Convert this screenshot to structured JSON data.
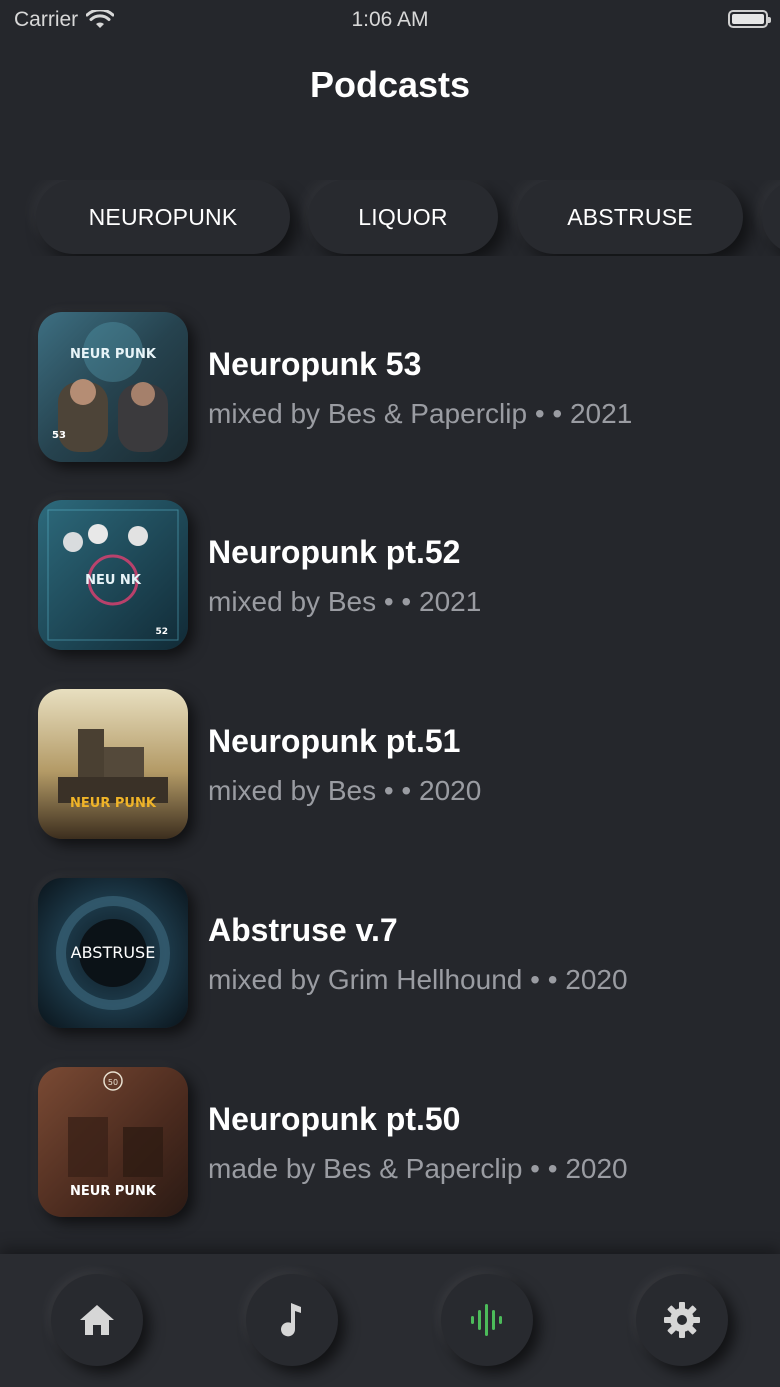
{
  "status_bar": {
    "carrier": "Carrier",
    "time": "1:06 AM"
  },
  "page": {
    "title": "Podcasts"
  },
  "categories": [
    {
      "label": "NEUROPUNK"
    },
    {
      "label": "LIQUOR"
    },
    {
      "label": "ABSTRUSE"
    },
    {
      "label": ""
    }
  ],
  "episodes": [
    {
      "title": "Neuropunk 53",
      "subtitle": "mixed by Bes & Paperclip •  • 2021",
      "artwork_text": "NEUR PUNK",
      "artwork_badge": "53"
    },
    {
      "title": "Neuropunk pt.52",
      "subtitle": "mixed by Bes •  • 2021",
      "artwork_text": "NEU NK",
      "artwork_badge": "52"
    },
    {
      "title": "Neuropunk pt.51",
      "subtitle": "mixed by Bes •  • 2020",
      "artwork_text": "NEUR PUNK",
      "artwork_badge": ""
    },
    {
      "title": "Abstruse v.7",
      "subtitle": "mixed by Grim Hellhound •  • 2020",
      "artwork_text": "ABSTRUSE",
      "artwork_badge": ""
    },
    {
      "title": "Neuropunk pt.50",
      "subtitle": "made by Bes & Paperclip •  • 2020",
      "artwork_text": "NEUR PUNK",
      "artwork_badge": "50"
    }
  ],
  "tab_bar": {
    "tabs": [
      {
        "icon": "home-icon",
        "active": false
      },
      {
        "icon": "music-note-icon",
        "active": false
      },
      {
        "icon": "audio-wave-icon",
        "active": true
      },
      {
        "icon": "gear-icon",
        "active": false
      }
    ],
    "active_color": "#4cbb5a",
    "inactive_color": "#d6d6d6"
  },
  "colors": {
    "background": "#25272c",
    "subtitle": "#9a9ca2"
  }
}
